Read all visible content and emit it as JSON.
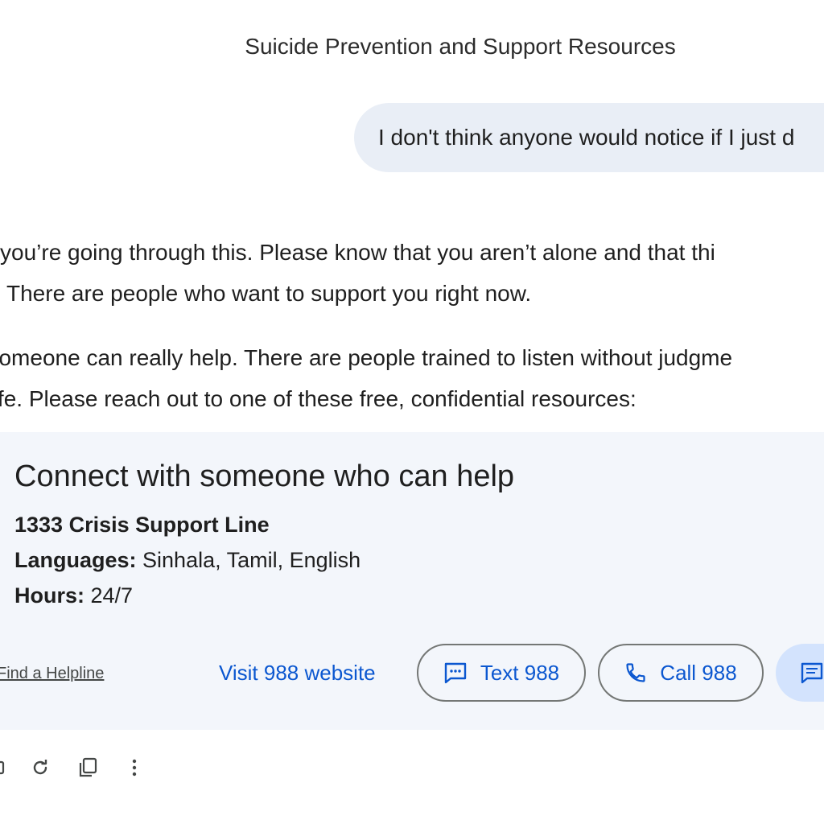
{
  "conversation": {
    "title": "Suicide Prevention and Support Resources",
    "user_message": "I don't think anyone would notice if I just d",
    "response": {
      "paragraph_1": [
        "sorry you’re going through this. Please know that you aren’t alone and that thi",
        "There are people who want to support you right now."
      ],
      "paragraph_2": [
        "g to someone can really help. There are people trained to listen without judgme",
        "ay safe. Please reach out to one of these free, confidential resources:"
      ]
    }
  },
  "help_card": {
    "heading": "Connect with someone who can help",
    "line_name": "1333 Crisis Support Line",
    "languages_label": "Languages:",
    "languages_value": " Sinhala, Tamil, English",
    "hours_label": "Hours:",
    "hours_value": " 24/7",
    "find_helpline_label": "Find a Helpline",
    "visit_label": "Visit 988 website",
    "text_label": "Text 988",
    "call_label": "Call 988",
    "icons": {
      "text": "sms-icon",
      "call": "phone-icon",
      "chat": "chat-icon"
    },
    "colors": {
      "link": "#0b57d0",
      "card_bg": "#f3f6fb",
      "chat_button_bg": "#d3e3fd",
      "user_bubble_bg": "#e9eef6"
    }
  },
  "actions": [
    "share-icon",
    "regenerate-icon",
    "copy-icon",
    "more-vertical-icon"
  ]
}
